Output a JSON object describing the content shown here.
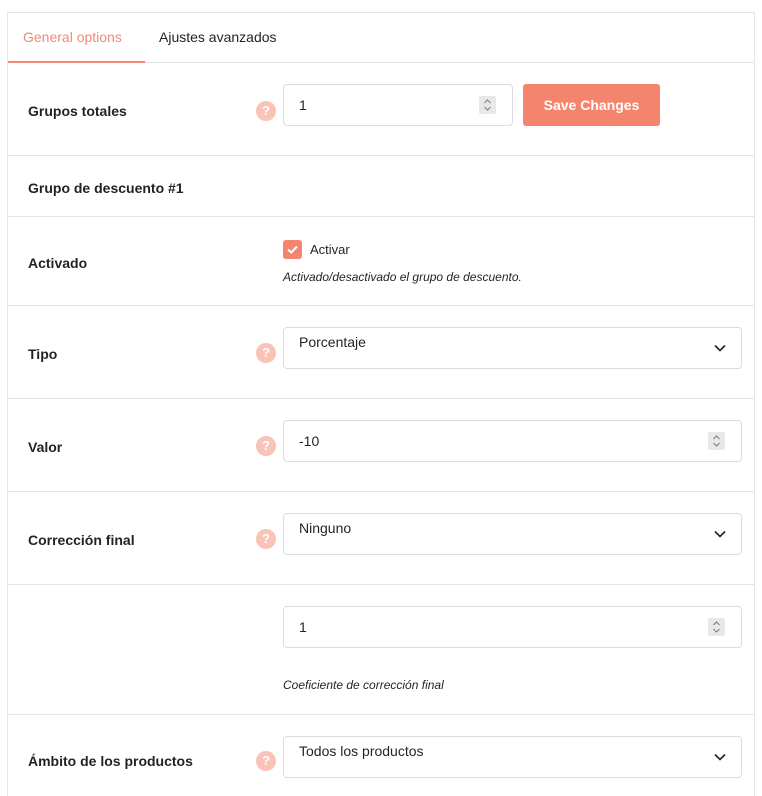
{
  "tabs": [
    {
      "label": "General options",
      "active": true
    },
    {
      "label": "Ajustes avanzados",
      "active": false
    }
  ],
  "help_glyph": "?",
  "grupos_totales": {
    "label": "Grupos totales",
    "value": "1"
  },
  "save_button": {
    "label": "Save Changes"
  },
  "grupo_heading": "Grupo de descuento #1",
  "activado": {
    "label": "Activado",
    "checkbox_label": "Activar",
    "checked": true,
    "description": "Activado/desactivado el grupo de descuento."
  },
  "tipo": {
    "label": "Tipo",
    "selected": "Porcentaje"
  },
  "valor": {
    "label": "Valor",
    "value": "-10"
  },
  "correccion_final": {
    "label": "Corrección final",
    "selected": "Ninguno"
  },
  "coeficiente": {
    "value": "1",
    "description": "Coeficiente de corrección final"
  },
  "ambito": {
    "label": "Ámbito de los productos",
    "selected": "Todos los productos"
  },
  "colors": {
    "accent": "#f5846f",
    "help": "#f9c3b7",
    "tab_active": "#f08a75"
  },
  "icons": {
    "help": "question-icon",
    "spinner": "number-spinner-icon",
    "dropdown": "chevron-down-icon",
    "check": "checkmark-icon"
  }
}
